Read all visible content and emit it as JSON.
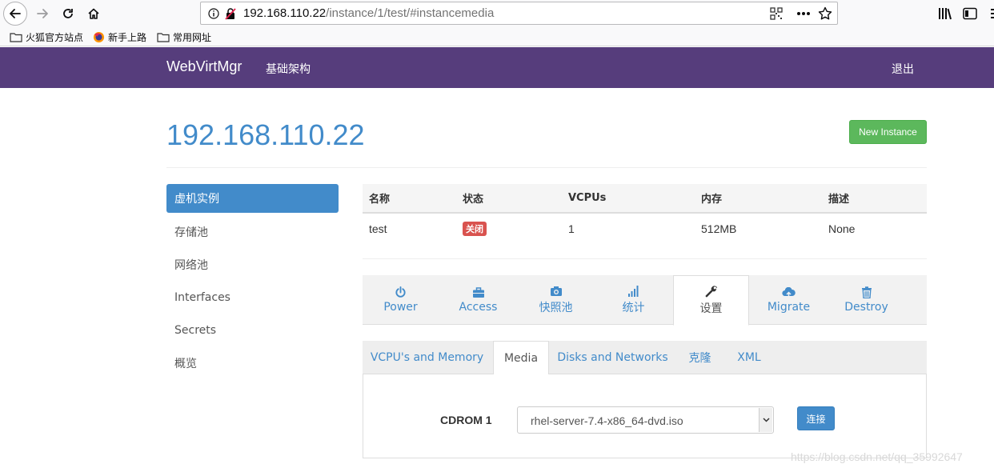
{
  "browser": {
    "url_host": "192.168.110.22",
    "url_path": "/instance/1/test/#instancemedia",
    "bookmarks": [
      "火狐官方站点",
      "新手上路",
      "常用网址"
    ]
  },
  "navbar": {
    "brand": "WebVirtMgr",
    "infra_link": "基础架构",
    "logout_link": "退出"
  },
  "header": {
    "host": "192.168.110.22",
    "new_instance_label": "New Instance"
  },
  "sidebar": {
    "items": [
      {
        "label": "虚机实例"
      },
      {
        "label": "存储池"
      },
      {
        "label": "网络池"
      },
      {
        "label": "Interfaces"
      },
      {
        "label": "Secrets"
      },
      {
        "label": "概览"
      }
    ]
  },
  "instance_table": {
    "headers": [
      "名称",
      "状态",
      "VCPUs",
      "内存",
      "描述"
    ],
    "row": {
      "name": "test",
      "status": "关闭",
      "vcpus": "1",
      "memory": "512MB",
      "description": "None"
    }
  },
  "action_tabs": [
    {
      "label": "Power",
      "icon": "power-icon"
    },
    {
      "label": "Access",
      "icon": "briefcase-icon"
    },
    {
      "label": "快照池",
      "icon": "camera-icon"
    },
    {
      "label": "统计",
      "icon": "signal-icon"
    },
    {
      "label": "设置",
      "icon": "wrench-icon"
    },
    {
      "label": "Migrate",
      "icon": "cloud-upload-icon"
    },
    {
      "label": "Destroy",
      "icon": "trash-icon"
    }
  ],
  "settings_tabs": [
    "VCPU's and Memory",
    "Media",
    "Disks and Networks",
    "克隆",
    "XML"
  ],
  "media": {
    "cdrom_label": "CDROM 1",
    "selected_iso": "rhel-server-7.4-x86_64-dvd.iso",
    "connect_label": "连接"
  },
  "watermark": "https://blog.csdn.net/qq_35992647",
  "colors": {
    "navbar": "#563d7c",
    "primary": "#428bca",
    "success": "#5cb85c",
    "danger": "#d9534f"
  }
}
